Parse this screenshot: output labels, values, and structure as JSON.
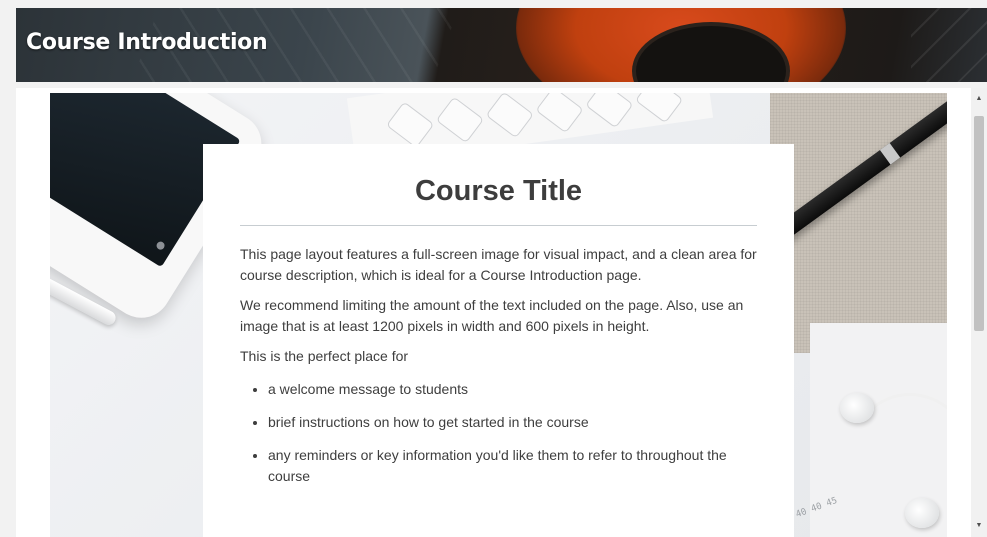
{
  "header": {
    "title": "Course Introduction"
  },
  "card": {
    "title": "Course Title",
    "paragraphs": [
      "This page layout features a full-screen image for visual impact, and a clean area for course description, which is ideal for a Course Introduction page.",
      "We recommend limiting the amount of the text included on the page. Also, use an image that is at least 1200 pixels in width and 600 pixels in height.",
      "This is the perfect place for"
    ],
    "list": [
      "a welcome message to students",
      "brief instructions on how to get started in the course",
      "any reminders or key information you'd like them to refer to throughout the course"
    ]
  },
  "scrollbar": {
    "up_icon": "triangle-up-icon",
    "down_icon": "triangle-down-icon",
    "up_glyph": "▲",
    "down_glyph": "▼"
  }
}
